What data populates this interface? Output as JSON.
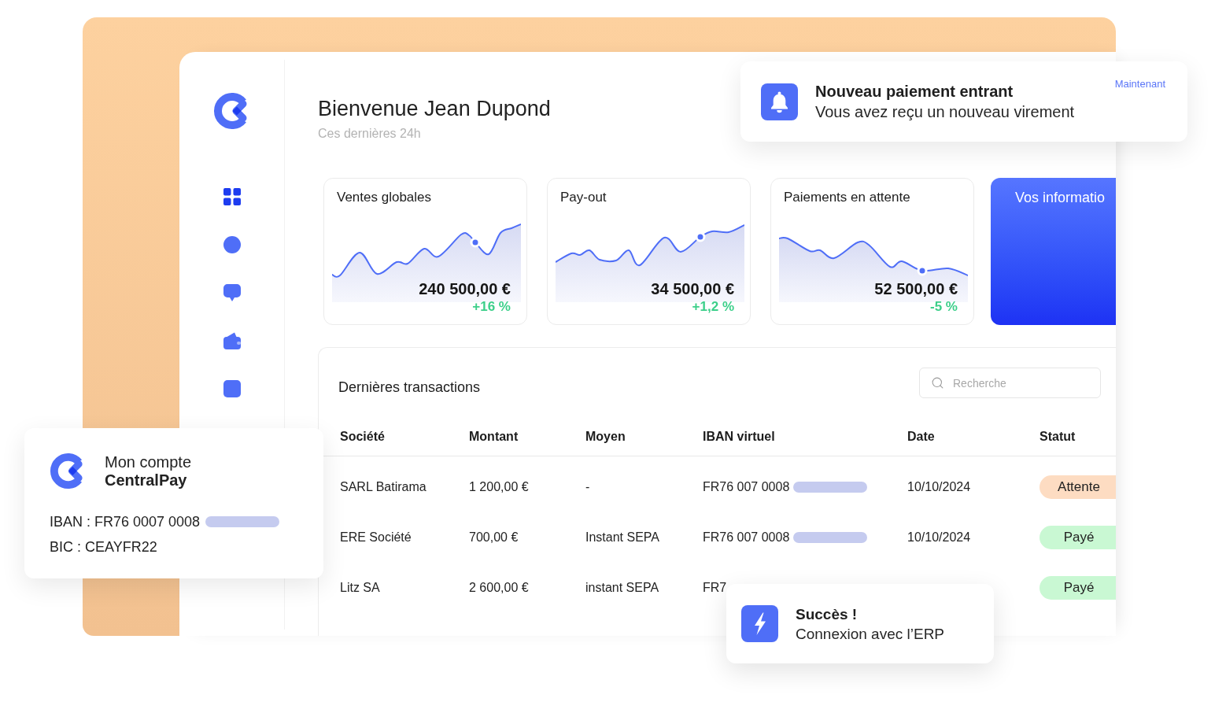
{
  "sidebar": {
    "items": [
      {
        "kind": "grid",
        "selected": true
      },
      {
        "kind": "circle",
        "selected": false
      },
      {
        "kind": "chat",
        "selected": false
      },
      {
        "kind": "wallet",
        "selected": false
      },
      {
        "kind": "square",
        "selected": false
      }
    ]
  },
  "header": {
    "title": "Bienvenue Jean Dupond",
    "subtitle": "Ces dernières 24h"
  },
  "stat_cards": [
    {
      "kind": "chart",
      "title": "Ventes globales",
      "value": "240 500,00 €",
      "change": "+16 %"
    },
    {
      "kind": "chart",
      "title": "Pay-out",
      "value": "34 500,00 €",
      "change": "+1,2 %"
    },
    {
      "kind": "chart",
      "title": "Paiements en attente",
      "value": "52 500,00 €",
      "change": "-5 %"
    },
    {
      "kind": "info",
      "title": "Vos informatio"
    }
  ],
  "transactions": {
    "title": "Dernières transactions",
    "search": {
      "placeholder": "Recherche"
    },
    "columns": [
      "Société",
      "Montant",
      "Moyen",
      "IBAN virtuel",
      "Date",
      "Statut"
    ],
    "rows": [
      {
        "company": "SARL Batirama",
        "amount": "1 200,00 €",
        "method": "-",
        "iban": "FR76 007 0008",
        "iban_masked": true,
        "date": "10/10/2024",
        "status": {
          "kind": "pending",
          "label": "Attente"
        }
      },
      {
        "company": "ERE Société",
        "amount": "700,00 €",
        "method": "Instant SEPA",
        "iban": "FR76 007 0008",
        "iban_masked": true,
        "date": "10/10/2024",
        "status": {
          "kind": "paid",
          "label": "Payé"
        }
      },
      {
        "company": "Litz SA",
        "amount": "2 600,00 €",
        "method": "instant SEPA",
        "iban": "FR7",
        "iban_masked": false,
        "status": {
          "kind": "paid",
          "label": "Payé"
        }
      }
    ]
  },
  "notification": {
    "title": "Nouveau paiement entrant",
    "message": "Vous avez reçu un nouveau virement",
    "time": "Maintenant"
  },
  "account_card": {
    "title": "Mon compte",
    "brand": "CentralPay",
    "iban": "IBAN : FR76 0007 0008",
    "iban_masked": true,
    "bic": "BIC : CEAYFR22"
  },
  "toast": {
    "title": "Succès !",
    "message": "Connexion avec l’ERP"
  }
}
